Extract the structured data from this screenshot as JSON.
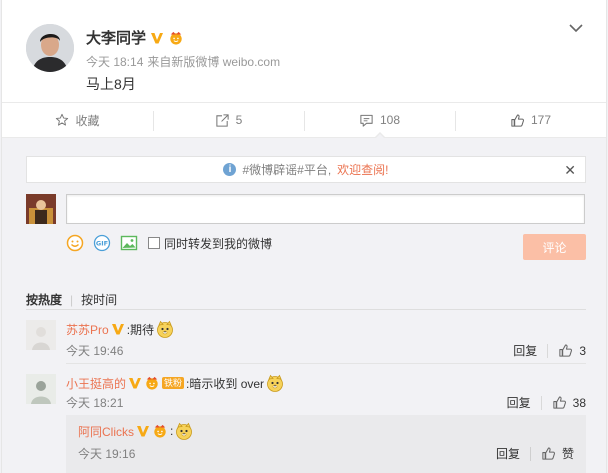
{
  "post": {
    "author": "大李同学",
    "time": "今天 18:14",
    "source_prefix": "来自",
    "source": "新版微博 weibo.com",
    "text": "马上8月"
  },
  "actions": {
    "favorite": "收藏",
    "repost_count": "5",
    "comment_count": "108",
    "like_count": "177"
  },
  "notice": {
    "text": "#微博辟谣#平台,",
    "link": "欢迎查阅!"
  },
  "composer": {
    "placeholder": "",
    "forward_label": "同时转发到我的微博",
    "submit": "评论"
  },
  "sort": {
    "by_hot": "按热度",
    "by_time": "按时间"
  },
  "comments": [
    {
      "name": "苏苏Pro",
      "text": ":期待",
      "time": "今天 19:46",
      "reply": "回复",
      "likes": "3"
    },
    {
      "name": "小王挺高的",
      "fan_badge": "铁粉",
      "text": ":暗示收到 over",
      "time": "今天 18:21",
      "reply": "回复",
      "likes": "38"
    }
  ],
  "sub_reply": {
    "name": "阿同Clicks",
    "text": ":",
    "time": "今天 19:16",
    "reply": "回复",
    "like_label": "赞"
  },
  "colors": {
    "accent": "#eb7350",
    "verified": "#f7a914",
    "muted": "#808080",
    "submit_disabled": "#fbbfa6"
  },
  "icons": [
    "favorite-star-icon",
    "repost-icon",
    "comment-icon",
    "thumbs-up-icon",
    "info-icon",
    "close-icon",
    "chevron-down-icon",
    "emoji-icon",
    "gif-icon",
    "image-icon",
    "doge-emoji"
  ]
}
